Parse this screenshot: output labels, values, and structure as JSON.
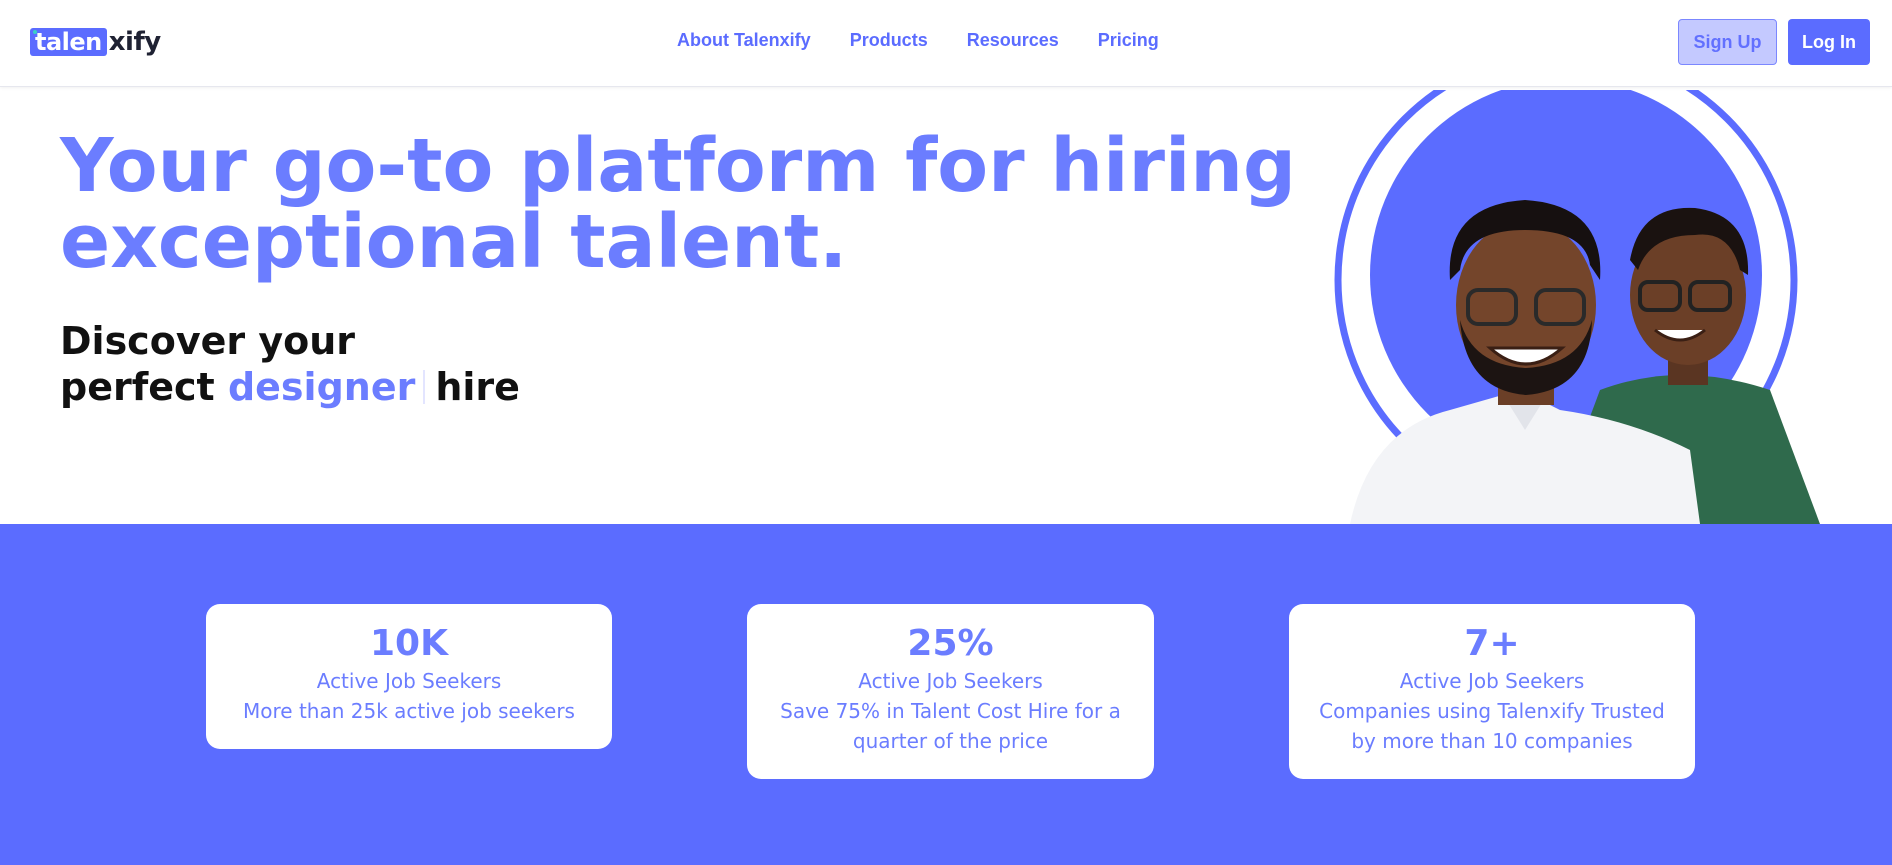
{
  "header": {
    "logo": {
      "part1": "talen",
      "part2": "xify"
    },
    "nav": [
      {
        "label": "About Talenxify"
      },
      {
        "label": "Products"
      },
      {
        "label": "Resources"
      },
      {
        "label": "Pricing"
      }
    ],
    "signup_label": "Sign Up",
    "login_label": "Log In"
  },
  "hero": {
    "headline_line1": "Your go-to platform for hiring",
    "headline_line2": "exceptional talent.",
    "sub_line1": "Discover your",
    "sub_prefix": "perfect",
    "sub_accent": "designer",
    "sub_suffix": "hire",
    "image": "two-smiling-men-portrait"
  },
  "stats": [
    {
      "value": "10K",
      "label": "Active Job Seekers",
      "desc": "More than 25k active job seekers"
    },
    {
      "value": "25%",
      "label": "Active Job Seekers",
      "desc": "Save 75% in Talent Cost Hire for a quarter of the price"
    },
    {
      "value": "7+",
      "label": "Active Job Seekers",
      "desc": "Companies using Talenxify Trusted by more than 10 companies"
    }
  ],
  "colors": {
    "brand": "#5b6cff",
    "accent_text": "#6b7dff",
    "signup_bg": "#c4c9ff"
  }
}
